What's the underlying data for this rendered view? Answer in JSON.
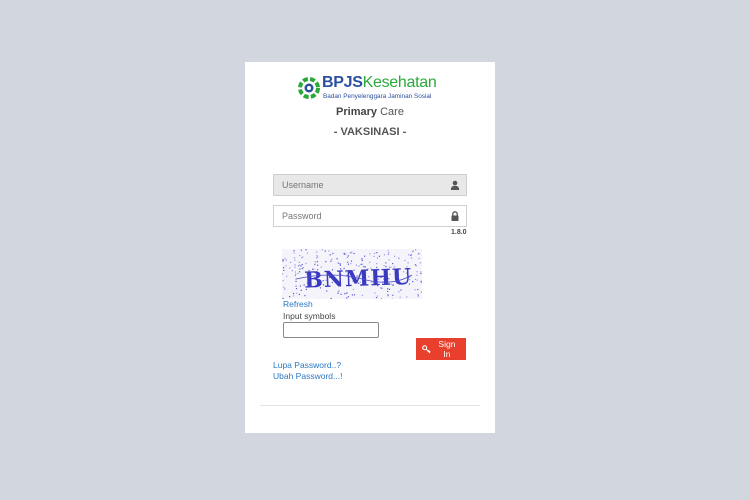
{
  "brand": {
    "name_part1": "BPJS",
    "name_part2": "Kesehatan",
    "tagline": "Badan Penyelenggara Jaminan Sosial"
  },
  "header": {
    "title_bold": "Primary",
    "title_rest": "Care",
    "subtitle": "- VAKSINASI -"
  },
  "form": {
    "username_placeholder": "Username",
    "username_value": "",
    "password_placeholder": "Password",
    "password_value": "",
    "version": "1.8.0",
    "captcha_text": "BNMHU",
    "refresh_label": "Refresh",
    "captcha_label": "Input symbols",
    "captcha_value": "",
    "signin_label": "Sign In"
  },
  "links": {
    "forgot_password": "Lupa Password..?",
    "change_password": "Ubah Password...!"
  },
  "icons": {
    "username": "user-icon",
    "password": "lock-icon",
    "signin": "key-icon"
  },
  "colors": {
    "background": "#d2d6de",
    "brand_blue": "#2c4fa0",
    "brand_green": "#2aa83a",
    "signin": "#e8402c",
    "link": "#2a78c2"
  }
}
